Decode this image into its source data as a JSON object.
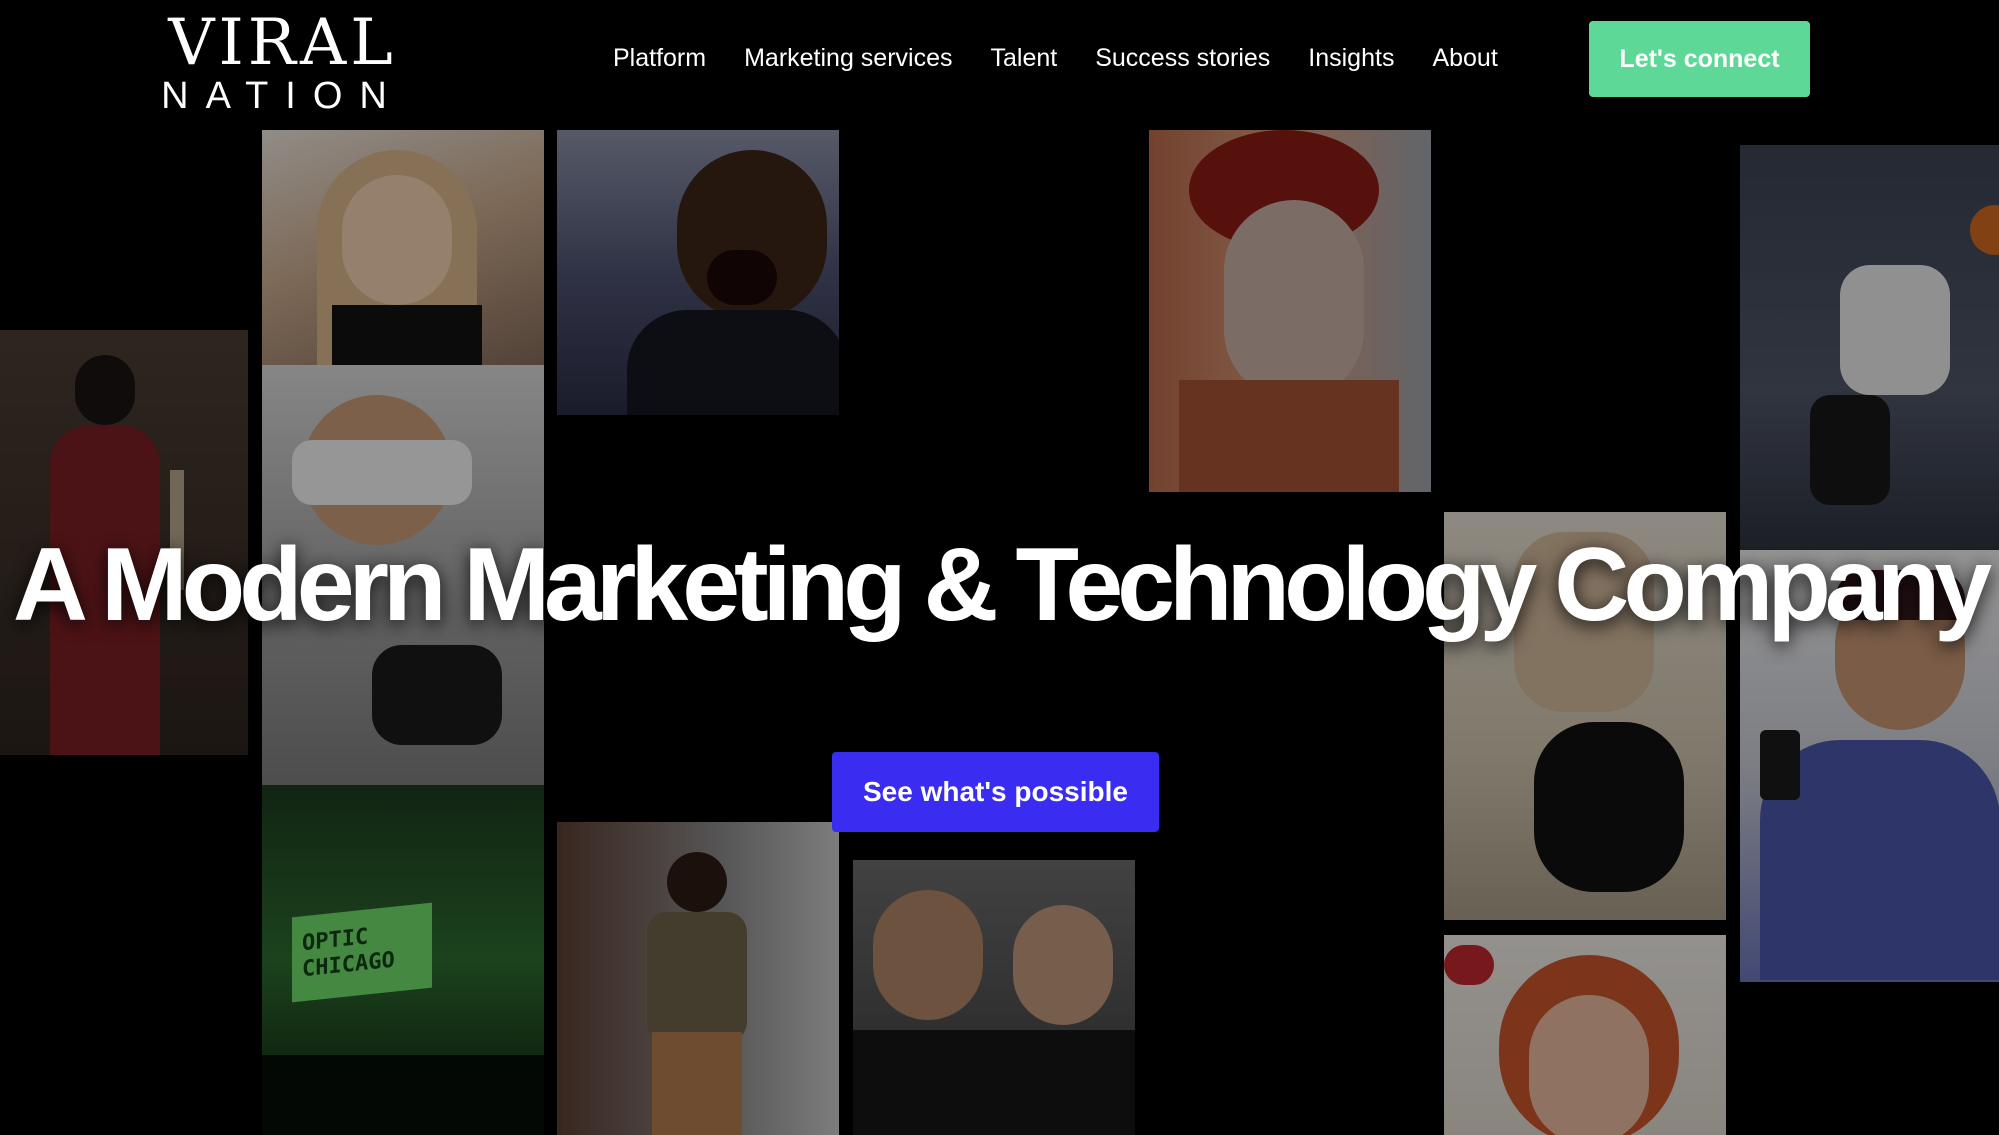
{
  "brand": {
    "logo_top": "VIRAL",
    "logo_bottom": "NATION"
  },
  "nav": {
    "links": [
      "Platform",
      "Marketing services",
      "Talent",
      "Success stories",
      "Insights",
      "About"
    ],
    "cta_label": "Let's connect"
  },
  "hero": {
    "title": "A Modern Marketing & Technology Company",
    "button_label": "See what's possible"
  },
  "collage": {
    "tiles": [
      {
        "subject": "blonde-woman-photo"
      },
      {
        "subject": "laughing-man-photo"
      },
      {
        "subject": "cosplay-red-dress-photo"
      },
      {
        "subject": "vr-headset-player-photo"
      },
      {
        "subject": "face-paint-portrait-photo"
      },
      {
        "subject": "basketball-dunk-photo"
      },
      {
        "subject": "woman-with-cat-photo"
      },
      {
        "subject": "surprised-man-phone-photo"
      },
      {
        "subject": "esports-arena-photo",
        "text": "OPTIC CHICAGO"
      },
      {
        "subject": "street-fashion-photo"
      },
      {
        "subject": "friends-selfie-photo"
      },
      {
        "subject": "redhead-laughing-photo"
      }
    ]
  },
  "colors": {
    "cta_green": "#5ed896",
    "hero_button": "#3a2cf0",
    "background": "#000000"
  }
}
